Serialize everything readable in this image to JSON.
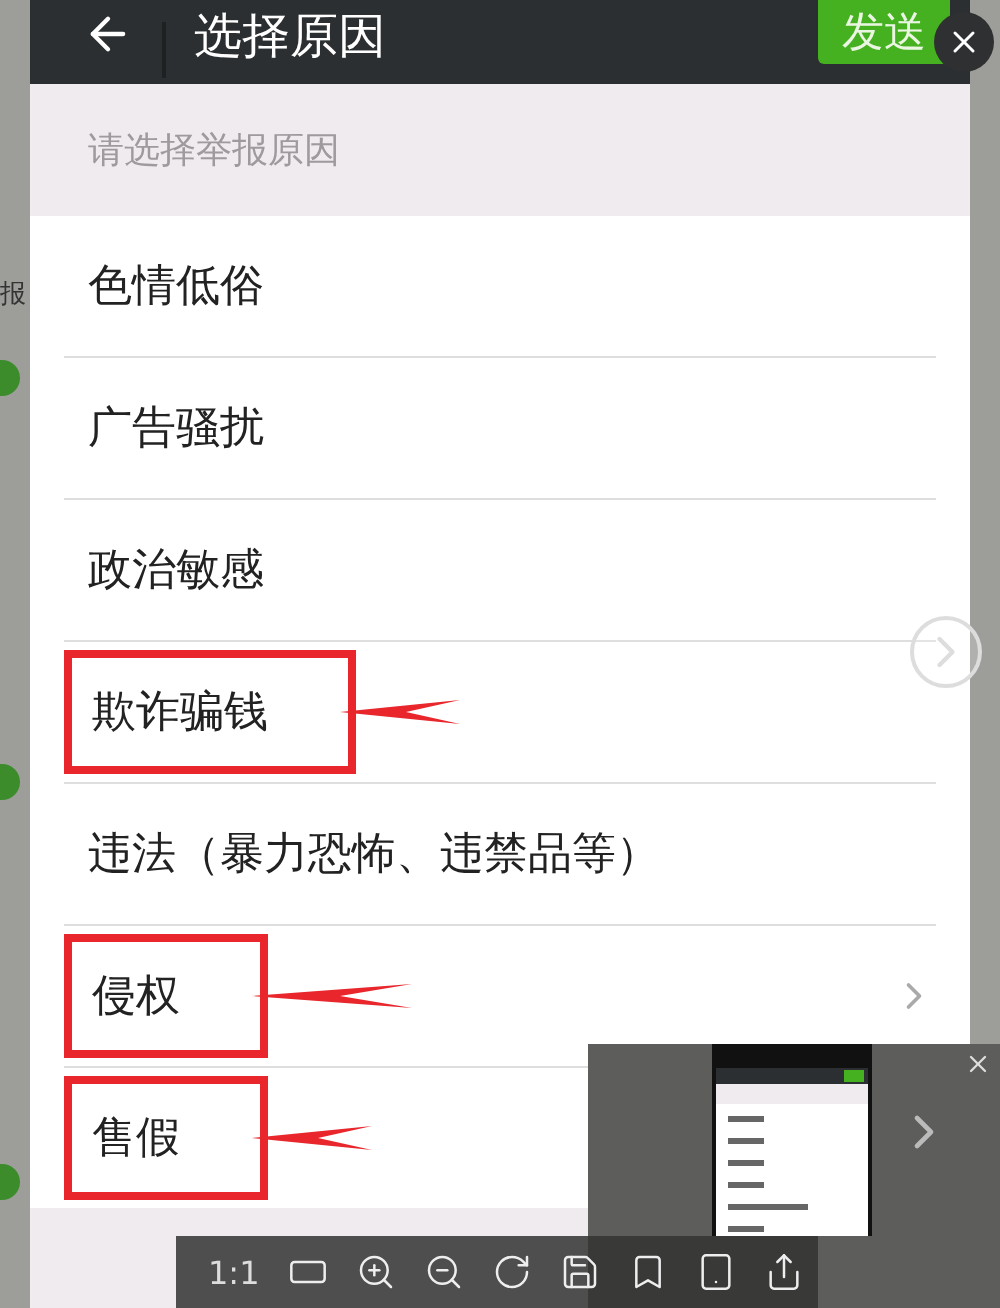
{
  "top_bar": {
    "title": "选择原因",
    "send_button": "发送"
  },
  "section_header": "请选择举报原因",
  "reasons": [
    {
      "label": "色情低俗",
      "has_chevron": false,
      "highlighted": false
    },
    {
      "label": "广告骚扰",
      "has_chevron": false,
      "highlighted": false
    },
    {
      "label": "政治敏感",
      "has_chevron": false,
      "highlighted": false
    },
    {
      "label": "欺诈骗钱",
      "has_chevron": false,
      "highlighted": true
    },
    {
      "label": "违法（暴力恐怖、违禁品等）",
      "has_chevron": false,
      "highlighted": false
    },
    {
      "label": "侵权",
      "has_chevron": true,
      "highlighted": true
    },
    {
      "label": "售假",
      "has_chevron": false,
      "highlighted": true
    }
  ],
  "side_label": "报",
  "toolbar": {
    "zoom_label": "1:1"
  }
}
